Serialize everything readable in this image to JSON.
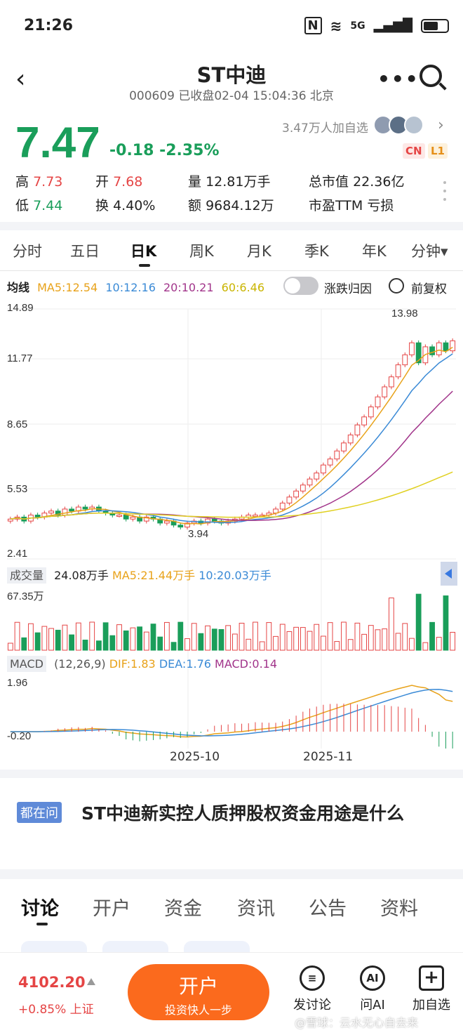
{
  "status": {
    "time": "21:26",
    "network": "5G"
  },
  "header": {
    "title": "ST中迪",
    "subtitle": "000609 已收盘02-04 15:04:36 北京"
  },
  "quote": {
    "price": "7.47",
    "change": "-0.18 -2.35%",
    "watchers": "3.47万人加自选",
    "tag_cn": "CN",
    "tag_l1": "L1",
    "stats": [
      {
        "label": "高",
        "value": "7.73"
      },
      {
        "label": "开",
        "value": "7.68"
      },
      {
        "label": "量",
        "value": "12.81万手"
      },
      {
        "label": "总市值",
        "value": "22.36亿"
      },
      {
        "label": "低",
        "value": "7.44"
      },
      {
        "label": "换",
        "value": "4.40%"
      },
      {
        "label": "额",
        "value": "9684.12万"
      },
      {
        "label": "市盈TTM",
        "value": "亏损"
      }
    ]
  },
  "kline_tabs": [
    "分时",
    "五日",
    "日K",
    "周K",
    "月K",
    "季K",
    "年K",
    "分钟▾"
  ],
  "ma_legend": {
    "title": "均线",
    "ma5": "MA5:12.54",
    "ma10": "10:12.16",
    "ma20": "20:10.21",
    "ma60": "60:6.46",
    "toggle_label": "涨跌归因",
    "fuquan": "前复权",
    "colors": {
      "ma5": "#e8a21a",
      "ma10": "#3a8ad6",
      "ma20": "#a1348a",
      "ma60": "#e0d020"
    }
  },
  "chart_data": {
    "type": "candlestick",
    "y_ticks": [
      "14.89",
      "11.77",
      "8.65",
      "5.53",
      "2.41"
    ],
    "ylim": [
      2.41,
      14.89
    ],
    "x_ticks": [
      "2025-10",
      "2025-11"
    ],
    "annotations": {
      "high": "13.98",
      "low": "3.94"
    },
    "closes": [
      4.4,
      4.5,
      4.3,
      4.6,
      4.5,
      4.7,
      4.8,
      4.6,
      4.9,
      4.8,
      5.0,
      4.9,
      5.0,
      4.8,
      4.7,
      4.6,
      4.6,
      4.4,
      4.5,
      4.3,
      4.5,
      4.4,
      4.2,
      4.3,
      4.1,
      4.0,
      4.2,
      4.3,
      4.2,
      4.4,
      4.3,
      4.2,
      4.3,
      4.4,
      4.5,
      4.6,
      4.6,
      4.6,
      4.7,
      4.9,
      5.2,
      5.5,
      5.8,
      6.1,
      6.4,
      6.7,
      7.1,
      7.4,
      7.8,
      8.2,
      8.6,
      9.1,
      9.5,
      10.0,
      10.5,
      11.0,
      11.5,
      12.1,
      12.6,
      13.2,
      12.2,
      13.0,
      12.6,
      13.2,
      12.8,
      13.3
    ],
    "volume": {
      "label": "成交量",
      "value": "24.08万手",
      "ma5": "MA5:21.44万手",
      "ma10": "10:20.03万手",
      "max_label": "67.35万"
    },
    "macd": {
      "label": "MACD",
      "params": "(12,26,9)",
      "dif": "DIF:1.83",
      "dea": "DEA:1.76",
      "macd": "MACD:0.14",
      "top": "1.96",
      "bottom": "-0.20"
    }
  },
  "ask": {
    "tag": "都在问",
    "text": "ST中迪新实控人质押股权资金用途是什么"
  },
  "bottom_tabs": [
    "讨论",
    "开户",
    "资金",
    "资讯",
    "公告",
    "资料"
  ],
  "bottom_bar": {
    "index_value": "4102.20",
    "index_change": "+0.85% 上证",
    "open_btn": "开户",
    "open_sub": "投资快人一步",
    "actions": [
      "发讨论",
      "问AI",
      "加自选"
    ],
    "ai_icon": "AI",
    "watermark": "@雪球：云水无心自去来"
  }
}
